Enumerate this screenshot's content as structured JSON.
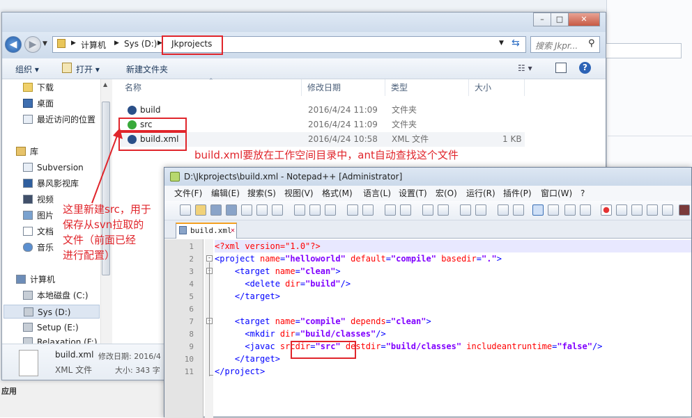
{
  "explorer": {
    "window_buttons": {
      "minimize": "–",
      "maximize": "□",
      "close": "✕"
    },
    "breadcrumb": [
      "计算机",
      "Sys (D:)",
      "Jkprojects"
    ],
    "search_placeholder": "搜索 Jkpr...",
    "toolbar": {
      "organize": "组织 ▾",
      "open": "打开 ▾",
      "new_folder": "新建文件夹"
    },
    "sidebar": [
      "下载",
      "桌面",
      "最近访问的位置",
      "库",
      "Subversion",
      "暴风影视库",
      "视频",
      "图片",
      "文档",
      "音乐",
      "计算机",
      "本地磁盘 (C:)",
      "Sys (D:)",
      "Setup (E:)",
      "Relaxation (F:)"
    ],
    "columns": {
      "name": "名称",
      "date": "修改日期",
      "type": "类型",
      "size": "大小"
    },
    "files": [
      {
        "name": "build",
        "date": "2016/4/24 11:09",
        "type": "文件夹",
        "size": ""
      },
      {
        "name": "src",
        "date": "2016/4/24 11:09",
        "type": "文件夹",
        "size": ""
      },
      {
        "name": "build.xml",
        "date": "2016/4/24 10:58",
        "type": "XML 文件",
        "size": "1 KB"
      }
    ],
    "details": {
      "filename": "build.xml",
      "date_label": "修改日期: 2016/4",
      "type": "XML 文件",
      "size_label": "大小: 343 字"
    }
  },
  "annotations": {
    "top": "build.xml要放在工作空间目录中，ant自动查找这个文件",
    "left_lines": [
      "这里新建src，用于",
      "保存从svn拉取的",
      "文件（前面已经",
      "进行配置）"
    ]
  },
  "background": {
    "bottom_label": "应用"
  },
  "notepad": {
    "title": "D:\\Jkprojects\\build.xml - Notepad++ [Administrator]",
    "menu": [
      "文件(F)",
      "编辑(E)",
      "搜索(S)",
      "视图(V)",
      "格式(M)",
      "语言(L)",
      "设置(T)",
      "宏(O)",
      "运行(R)",
      "插件(P)",
      "窗口(W)",
      "?"
    ],
    "tab": "build.xml",
    "line_numbers": [
      "1",
      "2",
      "3",
      "4",
      "5",
      "6",
      "7",
      "8",
      "9",
      "10",
      "11"
    ],
    "code": [
      [
        [
          "pi",
          "<?xml version=\"1.0\"?>"
        ]
      ],
      [
        [
          "tg",
          "<project "
        ],
        [
          "at",
          "name"
        ],
        [
          "tg",
          "="
        ],
        [
          "vl",
          "\"helloworld\""
        ],
        [
          "tg",
          " "
        ],
        [
          "at",
          "default"
        ],
        [
          "tg",
          "="
        ],
        [
          "vl",
          "\"compile\""
        ],
        [
          "tg",
          " "
        ],
        [
          "at",
          "basedir"
        ],
        [
          "tg",
          "="
        ],
        [
          "vl",
          "\".\""
        ],
        [
          "tg",
          ">"
        ]
      ],
      [
        [
          "tg",
          "    <target "
        ],
        [
          "at",
          "name"
        ],
        [
          "tg",
          "="
        ],
        [
          "vl",
          "\"clean\""
        ],
        [
          "tg",
          ">"
        ]
      ],
      [
        [
          "tg",
          "      <delete "
        ],
        [
          "at",
          "dir"
        ],
        [
          "tg",
          "="
        ],
        [
          "vl",
          "\"build\""
        ],
        [
          "tg",
          "/>"
        ]
      ],
      [
        [
          "tg",
          "    </target>"
        ]
      ],
      [
        [
          "tg",
          ""
        ]
      ],
      [
        [
          "tg",
          "    <target "
        ],
        [
          "at",
          "name"
        ],
        [
          "tg",
          "="
        ],
        [
          "vl",
          "\"compile\""
        ],
        [
          "tg",
          " "
        ],
        [
          "at",
          "depends"
        ],
        [
          "tg",
          "="
        ],
        [
          "vl",
          "\"clean\""
        ],
        [
          "tg",
          ">"
        ]
      ],
      [
        [
          "tg",
          "      <mkdir "
        ],
        [
          "at",
          "dir"
        ],
        [
          "tg",
          "="
        ],
        [
          "vl",
          "\"build/classes\""
        ],
        [
          "tg",
          "/>"
        ]
      ],
      [
        [
          "tg",
          "      <javac "
        ],
        [
          "at",
          "srcdir"
        ],
        [
          "tg",
          "="
        ],
        [
          "vl",
          "\"src\""
        ],
        [
          "tg",
          " "
        ],
        [
          "at",
          "destdir"
        ],
        [
          "tg",
          "="
        ],
        [
          "vl",
          "\"build/classes\""
        ],
        [
          "tg",
          " "
        ],
        [
          "at",
          "includeantruntime"
        ],
        [
          "tg",
          "="
        ],
        [
          "vl",
          "\"false\""
        ],
        [
          "tg",
          "/>"
        ]
      ],
      [
        [
          "tg",
          "    </target>"
        ]
      ],
      [
        [
          "tg",
          "</project>"
        ]
      ]
    ]
  },
  "colors": {
    "annotation_red": "#e0252b",
    "xml_tag": "#0000ff",
    "xml_attr": "#ff0000",
    "xml_value": "#8000ff"
  }
}
